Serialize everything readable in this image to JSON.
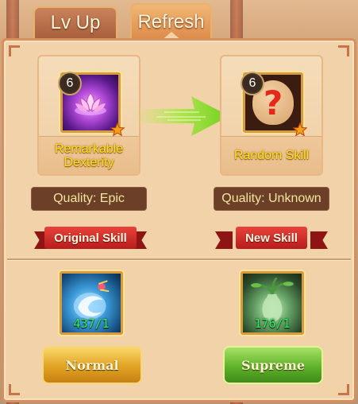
{
  "tabs": [
    {
      "label": "Lv Up",
      "active": false
    },
    {
      "label": "Refresh",
      "active": true
    }
  ],
  "current_skill": {
    "level": "6",
    "name": "Remarkable Dexterity",
    "quality": "Quality: Epic",
    "tag": "Original Skill",
    "icon": "lotus-icon"
  },
  "new_skill": {
    "level": "6",
    "name": "Random Skill",
    "quality": "Quality: Unknown",
    "tag": "New Skill",
    "icon": "question-mark-icon"
  },
  "items": [
    {
      "icon": "blue-orb-item-icon",
      "count": "437/1"
    },
    {
      "icon": "green-vase-item-icon",
      "count": "176/1"
    }
  ],
  "buttons": {
    "normal_label": "Normal",
    "supreme_label": "Supreme"
  },
  "colors": {
    "skill_name": "#f9e51a",
    "quality_text": "#f6e59c",
    "ribbon": "#d12b25",
    "count": "#34ee6a"
  }
}
